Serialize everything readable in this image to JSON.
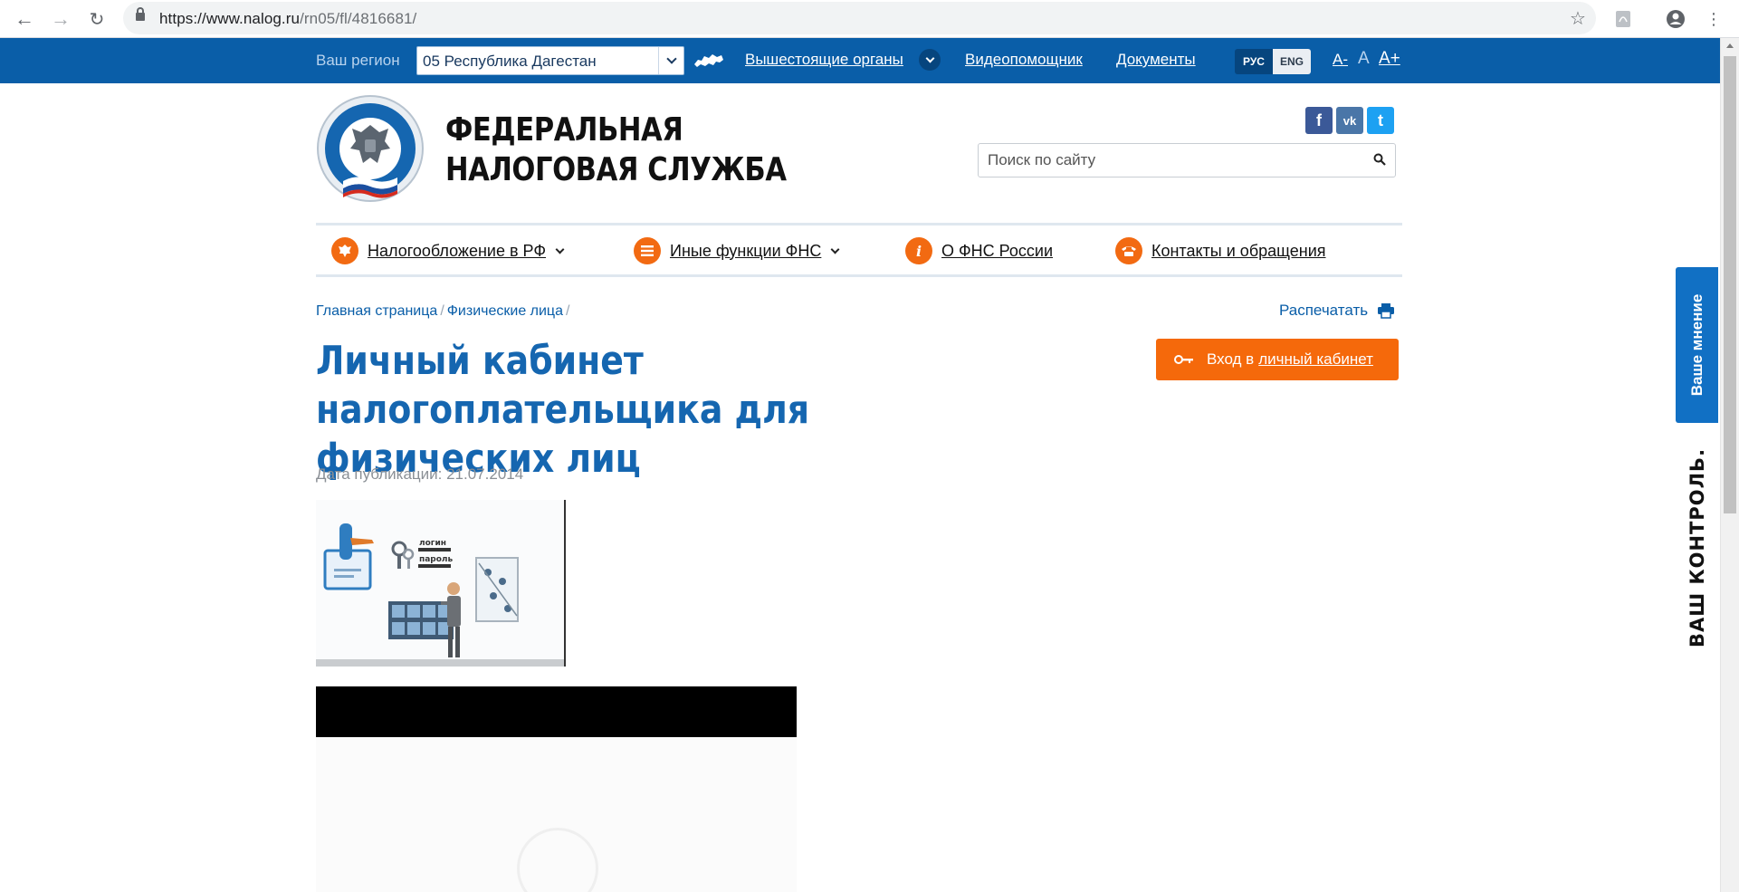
{
  "browser": {
    "url_host": "https://www.nalog.ru",
    "url_path": "/rn05/fl/4816681/"
  },
  "topbar": {
    "region_label": "Ваш регион",
    "region_value": "05 Республика Дагестан",
    "links": {
      "higher_authorities": "Вышестоящие органы",
      "video_assistant": "Видеопомощник",
      "documents": "Документы"
    },
    "lang_ru": "РУС",
    "lang_en": "ENG",
    "font_smaller": "A-",
    "font_normal": "A",
    "font_larger": "A+"
  },
  "header": {
    "brand_line1": "ФЕДЕРАЛЬНАЯ",
    "brand_line2": "НАЛОГОВАЯ СЛУЖБА",
    "search_placeholder": "Поиск по сайту",
    "social": {
      "facebook": "f",
      "vk": "vk",
      "twitter": "t"
    }
  },
  "menu": {
    "items": [
      {
        "label": "Налогообложение в РФ",
        "icon": "emblem-icon",
        "dropdown": true
      },
      {
        "label": "Иные функции ФНС",
        "icon": "list-icon",
        "dropdown": true
      },
      {
        "label": "О ФНС России",
        "icon": "info-icon",
        "dropdown": false
      },
      {
        "label": "Контакты и обращения",
        "icon": "phone-icon",
        "dropdown": false
      }
    ]
  },
  "content": {
    "breadcrumb": [
      "Главная страница",
      "Физические лица"
    ],
    "breadcrumb_sep": "/",
    "print_label": "Распечатать",
    "title": "Личный кабинет налогоплательщика для физических лиц",
    "login_button_prefix": "Вход в",
    "login_button_link": "личный кабинет",
    "pub_date": "Дата публикации: 21.07.2014",
    "illustration_words": {
      "login": "логин",
      "password": "пароль"
    }
  },
  "side": {
    "feedback": "Ваше мнение",
    "kontrol": "ВАШ КОНТРОЛЬ."
  },
  "colors": {
    "brand_blue": "#0a5ea8",
    "title_blue": "#1566b0",
    "accent_orange": "#f5690b",
    "feedback_blue": "#1170c4"
  }
}
